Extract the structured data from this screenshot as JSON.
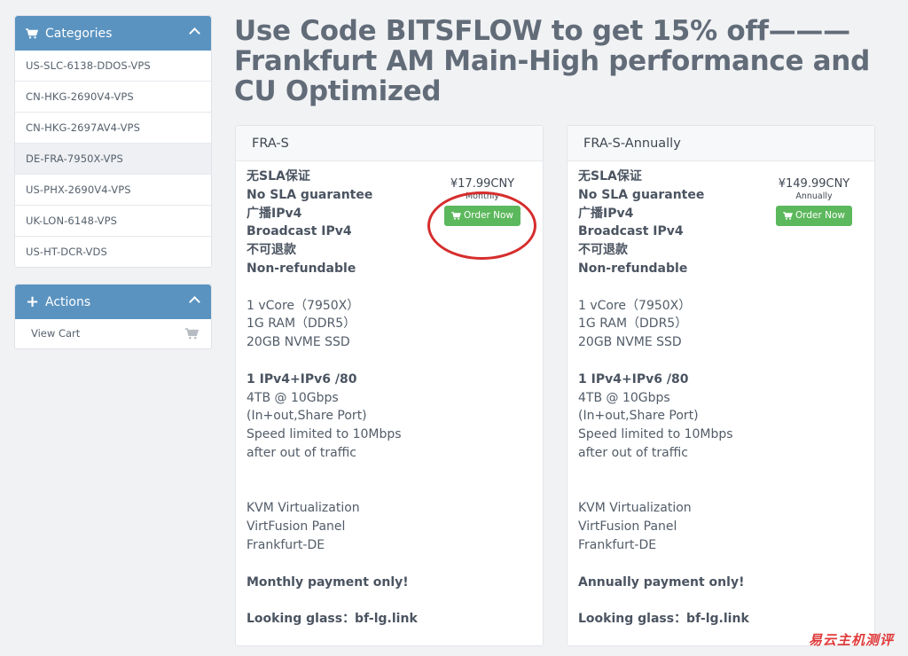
{
  "categories": {
    "title": "Categories",
    "items": [
      "US-SLC-6138-DDOS-VPS",
      "CN-HKG-2690V4-VPS",
      "CN-HKG-2697AV4-VPS",
      "DE-FRA-7950X-VPS",
      "US-PHX-2690V4-VPS",
      "UK-LON-6148-VPS",
      "US-HT-DCR-VDS"
    ]
  },
  "actions": {
    "title": "Actions",
    "items": [
      "View Cart"
    ]
  },
  "page": {
    "title": "Use Code BITSFLOW to get 15% off——— Frankfurt AM Main-High performance and CU Optimized"
  },
  "products": [
    {
      "name": "FRA-S",
      "price": "¥17.99CNY",
      "period": "Monthly",
      "order_label": "Order Now",
      "sla_cn": "无SLA保证",
      "sla_en": "No SLA guarantee",
      "ip_cn": "广播IPv4",
      "ip_en": "Broadcast IPv4",
      "refund_cn": "不可退款",
      "refund_en": "Non-refundable",
      "cpu": "1 vCore（7950X）",
      "ram": "1G RAM（DDR5）",
      "disk": "20GB NVME SSD",
      "network": "1 IPv4+IPv6 /80",
      "traffic": "4TB @ 10Gbps",
      "port": "(In+out,Share Port)",
      "limit": "Speed limited to 10Mbps",
      "limit2": "after out of traffic",
      "virt": "KVM Virtualization",
      "panel": "VirtFusion Panel",
      "location": "Frankfurt-DE",
      "payment": "Monthly payment only!",
      "lg": "Looking glass：bf-lg.link"
    },
    {
      "name": "FRA-S-Annually",
      "price": "¥149.99CNY",
      "period": "Annually",
      "order_label": "Order Now",
      "sla_cn": "无SLA保证",
      "sla_en": "No SLA guarantee",
      "ip_cn": "广播IPv4",
      "ip_en": "Broadcast IPv4",
      "refund_cn": "不可退款",
      "refund_en": "Non-refundable",
      "cpu": "1 vCore（7950X）",
      "ram": "1G RAM（DDR5）",
      "disk": "20GB NVME SSD",
      "network": "1 IPv4+IPv6 /80",
      "traffic": "4TB @ 10Gbps",
      "port": "(In+out,Share Port)",
      "limit": "Speed limited to 10Mbps",
      "limit2": "after out of traffic",
      "virt": "KVM Virtualization",
      "panel": "VirtFusion Panel",
      "location": "Frankfurt-DE",
      "payment": "Annually payment only!",
      "lg": "Looking glass：bf-lg.link"
    }
  ],
  "watermark": "易云主机测评",
  "colors": {
    "panel_header": "#5a93c0",
    "order_button": "#5cb85c",
    "highlight_ring": "#d62d2d"
  }
}
